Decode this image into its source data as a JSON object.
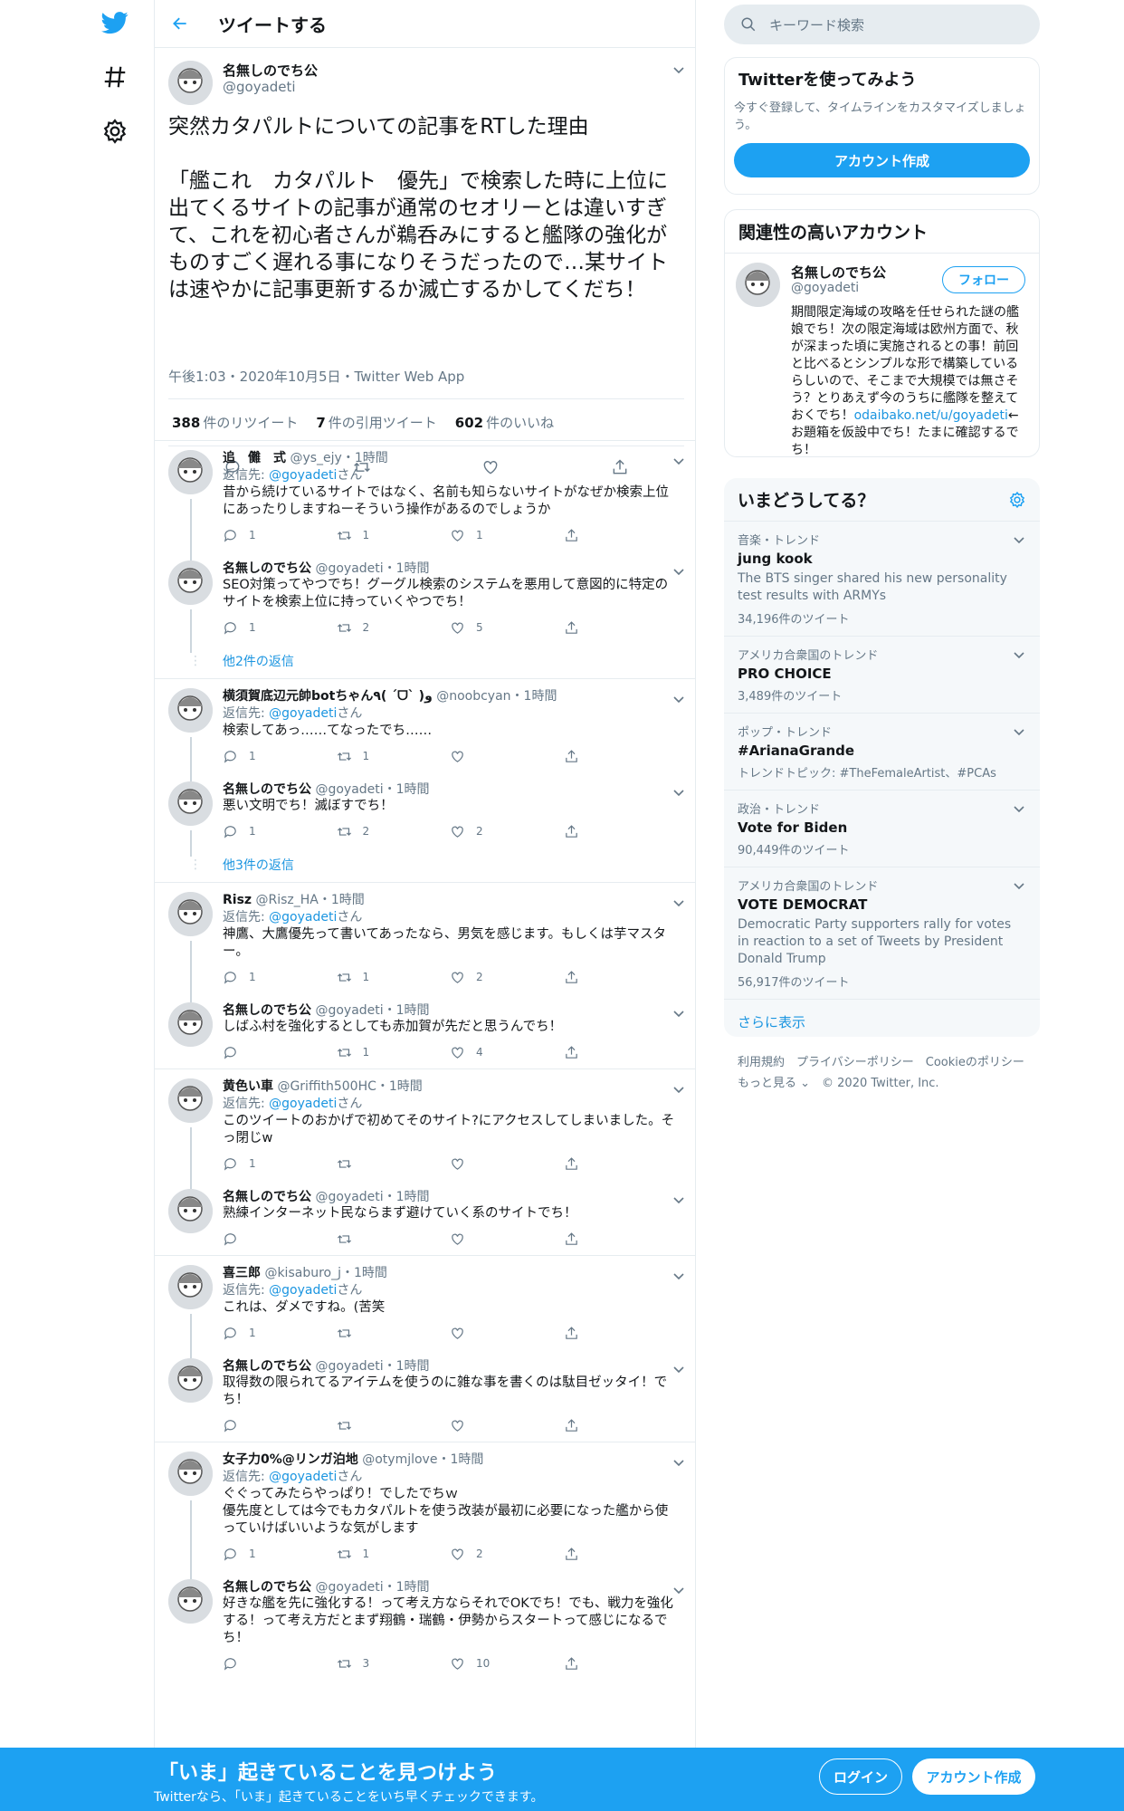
{
  "header": {
    "title": "ツイートする"
  },
  "focus": {
    "name": "名無しのでち公",
    "handle": "@goyadeti",
    "text": "突然カタパルトについての記事をRTした理由\n\n「艦これ　カタパルト　優先」で検索した時に上位に出てくるサイトの記事が通常のセオリーとは違いすぎて、これを初心者さんが鵜呑みにすると艦隊の強化がものすごく遅れる事になりそうだったので…某サイトは速やかに記事更新するか滅亡するかしてくだち！",
    "meta": "午後1:03・2020年10月5日・Twitter Web App",
    "retweets": "388",
    "retweets_label": "件のリツイート",
    "quotes": "7",
    "quotes_label": "件の引用ツイート",
    "likes": "602",
    "likes_label": "件のいいね"
  },
  "threads": [
    {
      "replies": [
        {
          "name": "追　儺　式",
          "handle": "@ys_ejy・1時間",
          "to": "返信先: ",
          "to_link": "@goyadeti",
          "to_suffix": "さん",
          "text": "昔から続けているサイトではなく、名前も知らないサイトがなぜか検索上位にあったりしますねーそういう操作があるのでしょうか",
          "reply": "1",
          "rt": "1",
          "like": "1"
        },
        {
          "name": "名無しのでち公",
          "handle": "@goyadeti・1時間",
          "text": "SEO対策ってやつでち！グーグル検索のシステムを悪用して意図的に特定のサイトを検索上位に持っていくやつでち！",
          "reply": "1",
          "rt": "2",
          "like": "5"
        }
      ],
      "more": "他2件の返信"
    },
    {
      "replies": [
        {
          "name": "横須賀底辺元帥botちゃん٩( ˊᗜˋ )و",
          "handle": "@noobcyan・1時間",
          "to": "返信先: ",
          "to_link": "@goyadeti",
          "to_suffix": "さん",
          "text": "検索してあっ……てなったでち……",
          "reply": "1",
          "rt": "1",
          "like": ""
        },
        {
          "name": "名無しのでち公",
          "handle": "@goyadeti・1時間",
          "text": "悪い文明でち！滅ぼすでち！",
          "reply": "1",
          "rt": "2",
          "like": "2"
        }
      ],
      "more": "他3件の返信"
    },
    {
      "replies": [
        {
          "name": "Risz",
          "handle": "@Risz_HA・1時間",
          "to": "返信先: ",
          "to_link": "@goyadeti",
          "to_suffix": "さん",
          "text": "神鷹、大鷹優先って書いてあったなら、男気を感じます。もしくは芋マスター。",
          "reply": "1",
          "rt": "1",
          "like": "2"
        },
        {
          "name": "名無しのでち公",
          "handle": "@goyadeti・1時間",
          "text": "しばふ村を強化するとしても赤加賀が先だと思うんでち！",
          "reply": "",
          "rt": "1",
          "like": "4"
        }
      ]
    },
    {
      "replies": [
        {
          "name": "黄色い車",
          "handle": "@Griffith500HC・1時間",
          "to": "返信先: ",
          "to_link": "@goyadeti",
          "to_suffix": "さん",
          "text": "このツイートのおかげで初めてそのサイト?にアクセスしてしまいました。そっ閉じw",
          "reply": "1",
          "rt": "",
          "like": ""
        },
        {
          "name": "名無しのでち公",
          "handle": "@goyadeti・1時間",
          "text": "熟練インターネット民ならまず避けていく系のサイトでち！",
          "reply": "",
          "rt": "",
          "like": ""
        }
      ]
    },
    {
      "replies": [
        {
          "name": "喜三郎",
          "handle": "@kisaburo_j・1時間",
          "to": "返信先: ",
          "to_link": "@goyadeti",
          "to_suffix": "さん",
          "text": "これは、ダメですね。(苦笑",
          "reply": "1",
          "rt": "",
          "like": ""
        },
        {
          "name": "名無しのでち公",
          "handle": "@goyadeti・1時間",
          "text": "取得数の限られてるアイテムを使うのに雑な事を書くのは駄目ゼッタイ！でち！",
          "reply": "",
          "rt": "",
          "like": ""
        }
      ]
    },
    {
      "replies": [
        {
          "name": "女子力0%@リンガ泊地",
          "handle": "@otymjlove・1時間",
          "to": "返信先: ",
          "to_link": "@goyadeti",
          "to_suffix": "さん",
          "text": "ぐぐってみたらやっぱり！でしたでちｗ\n優先度としては今でもカタパルトを使う改装が最初に必要になった艦から使っていけばいいような気がします",
          "reply": "1",
          "rt": "1",
          "like": "2"
        },
        {
          "name": "名無しのでち公",
          "handle": "@goyadeti・1時間",
          "text": "好きな艦を先に強化する！って考え方ならそれでOKでち！でも、戦力を強化する！って考え方だとまず翔鶴・瑞鶴・伊勢からスタートって感じになるでち！",
          "reply": "",
          "rt": "3",
          "like": "10"
        }
      ]
    }
  ],
  "sidebar": {
    "search_placeholder": "キーワード検索",
    "signup_title": "Twitterを使ってみよう",
    "signup_desc": "今すぐ登録して、タイムラインをカスタマイズしましょう。",
    "signup_button": "アカウント作成",
    "related_title": "関連性の高いアカウント",
    "related_name": "名無しのでち公",
    "related_handle": "@goyadeti",
    "follow_button": "フォロー",
    "related_bio_1": "期間限定海域の攻略を任せられた謎の艦娘でち！次の限定海域は欧州方面で、秋が深まった頃に実施されるとの事！前回と比べるとシンプルな形で構築しているらしいので、そこまで大規模では無さそう？とりあえず今のうちに艦隊を整えておくでち！",
    "related_bio_link": "odaibako.net/u/goyadeti",
    "related_bio_2": "←お題箱を仮設中でち！たまに確認するでち！",
    "trends_title": "いまどうしてる？",
    "trends": [
      {
        "meta": "音楽・トレンド",
        "name": "jung kook",
        "desc": "The BTS singer shared his new personality test results with ARMYs",
        "count": "34,196件のツイート"
      },
      {
        "meta": "アメリカ合衆国のトレンド",
        "name": "PRO CHOICE",
        "desc": "",
        "count": "3,489件のツイート"
      },
      {
        "meta": "ポップ・トレンド",
        "name": "#ArianaGrande",
        "desc": "",
        "count": "トレンドトピック: #TheFemaleArtist、#PCAs"
      },
      {
        "meta": "政治・トレンド",
        "name": "Vote for Biden",
        "desc": "",
        "count": "90,449件のツイート"
      },
      {
        "meta": "アメリカ合衆国のトレンド",
        "name": "VOTE DEMOCRAT",
        "desc": "Democratic Party supporters rally for votes in reaction to a set of Tweets by President Donald Trump",
        "count": "56,917件のツイート"
      }
    ],
    "show_more": "さらに表示",
    "footer_1": "利用規約　プライバシーポリシー　Cookieのポリシー",
    "footer_2": "もっと見る ⌄　© 2020 Twitter, Inc."
  },
  "bottom": {
    "title": "「いま」起きていることを見つけよう",
    "subtitle": "Twitterなら、「いま」起きていることをいち早くチェックできます。",
    "login": "ログイン",
    "signup": "アカウント作成"
  },
  "colors": {
    "accent": "#1da1f2",
    "link": "#1b95e0",
    "muted": "#657786",
    "border": "#e6ecf0"
  }
}
